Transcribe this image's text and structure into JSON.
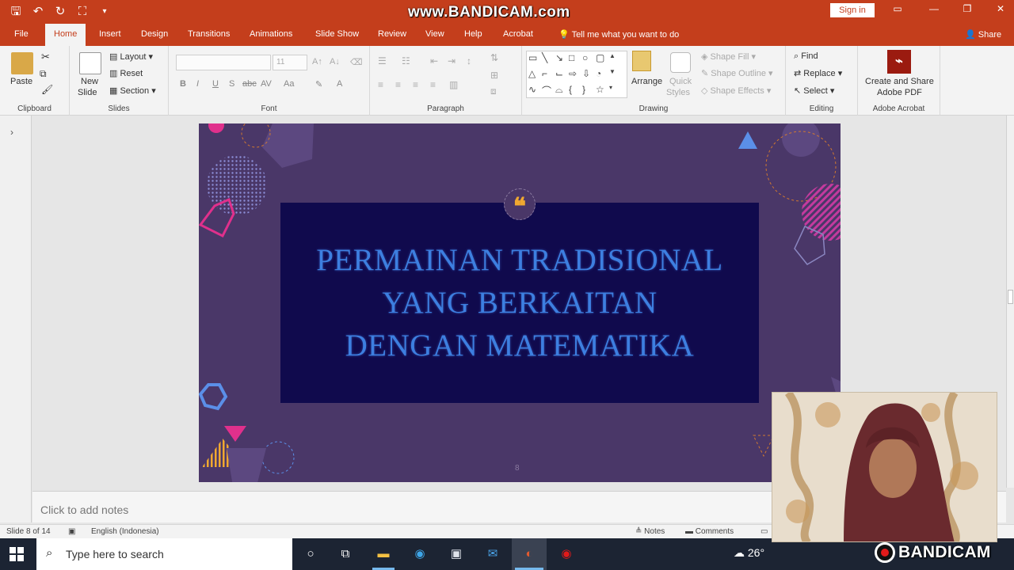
{
  "watermark": "www.BANDICAM.com",
  "window": {
    "sign_in": "Sign in",
    "share": "Share",
    "tell_me": "Tell me what you want to do"
  },
  "tabs": [
    "File",
    "Home",
    "Insert",
    "Design",
    "Transitions",
    "Animations",
    "Slide Show",
    "Review",
    "View",
    "Help",
    "Acrobat"
  ],
  "active_tab": "Home",
  "ribbon": {
    "clipboard": {
      "label": "Clipboard",
      "paste": "Paste"
    },
    "slides": {
      "label": "Slides",
      "new_slide_1": "New",
      "new_slide_2": "Slide",
      "layout": "Layout",
      "reset": "Reset",
      "section": "Section"
    },
    "font": {
      "label": "Font",
      "size": "11"
    },
    "paragraph": {
      "label": "Paragraph"
    },
    "drawing": {
      "label": "Drawing",
      "arrange": "Arrange",
      "quick_styles_1": "Quick",
      "quick_styles_2": "Styles",
      "shape_fill": "Shape Fill",
      "shape_outline": "Shape Outline",
      "shape_effects": "Shape Effects"
    },
    "editing": {
      "label": "Editing",
      "find": "Find",
      "replace": "Replace",
      "select": "Select"
    },
    "acrobat": {
      "label": "Adobe Acrobat",
      "create_1": "Create and Share",
      "create_2": "Adobe PDF"
    }
  },
  "slide": {
    "quote_glyph": "❝",
    "title_lines": [
      "PERMAINAN TRADISIONAL",
      "YANG BERKAITAN",
      "DENGAN MATEMATIKA"
    ],
    "page_number": "8"
  },
  "notes_placeholder": "Click to add notes",
  "status": {
    "slide_info": "Slide 8 of 14",
    "language": "English (Indonesia)",
    "notes": "Notes",
    "comments": "Comments"
  },
  "taskbar": {
    "search_placeholder": "Type here to search",
    "temperature": "26°"
  },
  "recorder_logo": "BANDICAM",
  "colors": {
    "accent": "#c43e1c",
    "slide_bg": "#4a3768",
    "title_box": "#100a4d",
    "title_text": "#3d7fe0",
    "taskbar": "#1c2433"
  }
}
